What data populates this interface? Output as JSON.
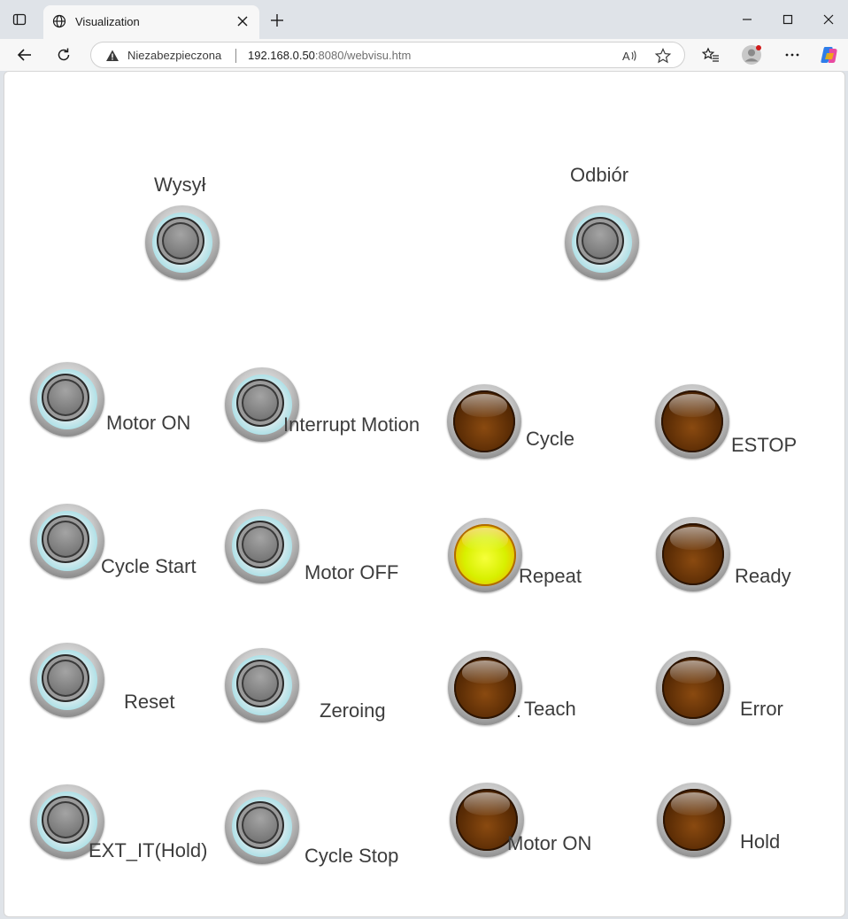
{
  "browser": {
    "tab_title": "Visualization",
    "security_label": "Niezabezpieczona",
    "url_host": "192.168.0.50",
    "url_rest": ":8080/webvisu.htm"
  },
  "visu": {
    "top_left_label": "Wysył",
    "top_right_label": "Odbiór",
    "buttons": [
      {
        "label": "Motor ON"
      },
      {
        "label": "Interrupt Motion"
      },
      {
        "label": "Cycle Start"
      },
      {
        "label": "Motor OFF"
      },
      {
        "label": "Reset"
      },
      {
        "label": "Zeroing"
      },
      {
        "label": "EXT_IT(Hold)"
      },
      {
        "label": "Cycle Stop"
      }
    ],
    "lamps": [
      {
        "label": "Cycle",
        "state": "off"
      },
      {
        "label": "ESTOP",
        "state": "off"
      },
      {
        "label": "Repeat",
        "state": "on"
      },
      {
        "label": "Ready",
        "state": "off"
      },
      {
        "label": "Teach",
        "state": "off"
      },
      {
        "label": "Error",
        "state": "off"
      },
      {
        "label": "Motor ON",
        "state": "off"
      },
      {
        "label": "Hold",
        "state": "off"
      }
    ]
  },
  "colors": {
    "lamp_off": "#5a2c05",
    "lamp_on": "#e0f000",
    "button_face": "#7c7c7c"
  }
}
